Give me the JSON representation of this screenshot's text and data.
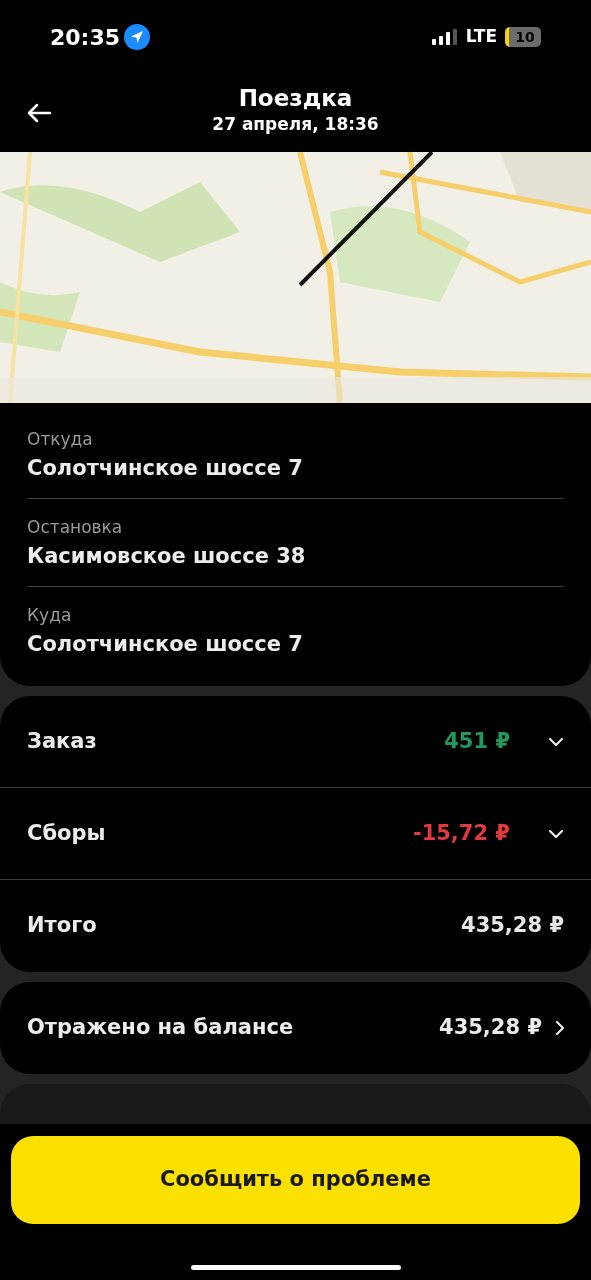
{
  "status_bar": {
    "time": "20:35",
    "network": "LTE",
    "battery": "10"
  },
  "header": {
    "title": "Поездка",
    "subtitle": "27 апреля, 18:36"
  },
  "route": [
    {
      "label": "Откуда",
      "address": "Солотчинское шоссе 7"
    },
    {
      "label": "Остановка",
      "address": "Касимовское шоссе 38"
    },
    {
      "label": "Куда",
      "address": "Солотчинское шоссе 7"
    }
  ],
  "price_rows": [
    {
      "kind": "expandable",
      "label": "Заказ",
      "amount": "451 ₽",
      "color": "#1f9a5a"
    },
    {
      "kind": "expandable",
      "label": "Сборы",
      "amount": "-15,72 ₽",
      "color": "#e0393e"
    },
    {
      "kind": "plain",
      "label": "Итого",
      "amount": "435,28 ₽",
      "color": "#e8e8e8"
    }
  ],
  "balance": {
    "label": "Отражено на балансе",
    "amount": "435,28 ₽"
  },
  "report_button": "Сообщить о проблеме"
}
